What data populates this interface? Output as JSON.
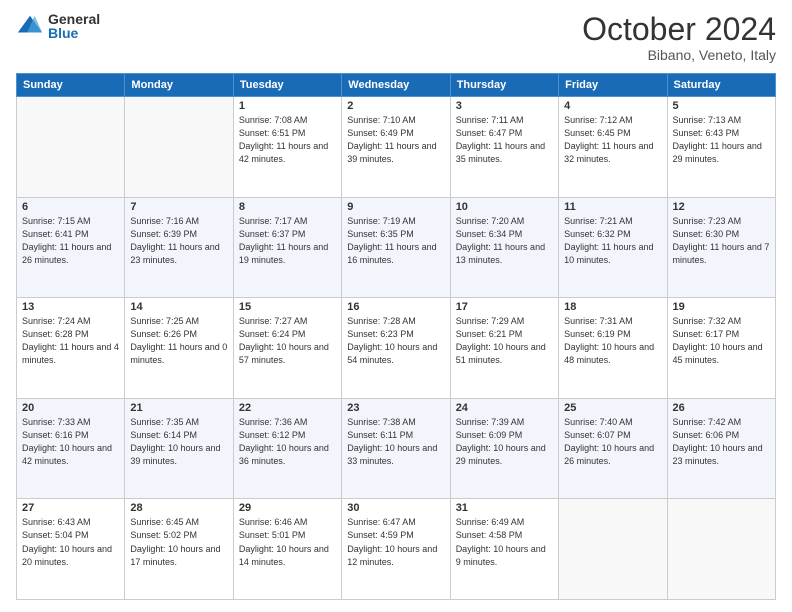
{
  "header": {
    "logo_general": "General",
    "logo_blue": "Blue",
    "month_title": "October 2024",
    "location": "Bibano, Veneto, Italy"
  },
  "weekdays": [
    "Sunday",
    "Monday",
    "Tuesday",
    "Wednesday",
    "Thursday",
    "Friday",
    "Saturday"
  ],
  "weeks": [
    [
      {
        "day": "",
        "info": ""
      },
      {
        "day": "",
        "info": ""
      },
      {
        "day": "1",
        "info": "Sunrise: 7:08 AM\nSunset: 6:51 PM\nDaylight: 11 hours and 42 minutes."
      },
      {
        "day": "2",
        "info": "Sunrise: 7:10 AM\nSunset: 6:49 PM\nDaylight: 11 hours and 39 minutes."
      },
      {
        "day": "3",
        "info": "Sunrise: 7:11 AM\nSunset: 6:47 PM\nDaylight: 11 hours and 35 minutes."
      },
      {
        "day": "4",
        "info": "Sunrise: 7:12 AM\nSunset: 6:45 PM\nDaylight: 11 hours and 32 minutes."
      },
      {
        "day": "5",
        "info": "Sunrise: 7:13 AM\nSunset: 6:43 PM\nDaylight: 11 hours and 29 minutes."
      }
    ],
    [
      {
        "day": "6",
        "info": "Sunrise: 7:15 AM\nSunset: 6:41 PM\nDaylight: 11 hours and 26 minutes."
      },
      {
        "day": "7",
        "info": "Sunrise: 7:16 AM\nSunset: 6:39 PM\nDaylight: 11 hours and 23 minutes."
      },
      {
        "day": "8",
        "info": "Sunrise: 7:17 AM\nSunset: 6:37 PM\nDaylight: 11 hours and 19 minutes."
      },
      {
        "day": "9",
        "info": "Sunrise: 7:19 AM\nSunset: 6:35 PM\nDaylight: 11 hours and 16 minutes."
      },
      {
        "day": "10",
        "info": "Sunrise: 7:20 AM\nSunset: 6:34 PM\nDaylight: 11 hours and 13 minutes."
      },
      {
        "day": "11",
        "info": "Sunrise: 7:21 AM\nSunset: 6:32 PM\nDaylight: 11 hours and 10 minutes."
      },
      {
        "day": "12",
        "info": "Sunrise: 7:23 AM\nSunset: 6:30 PM\nDaylight: 11 hours and 7 minutes."
      }
    ],
    [
      {
        "day": "13",
        "info": "Sunrise: 7:24 AM\nSunset: 6:28 PM\nDaylight: 11 hours and 4 minutes."
      },
      {
        "day": "14",
        "info": "Sunrise: 7:25 AM\nSunset: 6:26 PM\nDaylight: 11 hours and 0 minutes."
      },
      {
        "day": "15",
        "info": "Sunrise: 7:27 AM\nSunset: 6:24 PM\nDaylight: 10 hours and 57 minutes."
      },
      {
        "day": "16",
        "info": "Sunrise: 7:28 AM\nSunset: 6:23 PM\nDaylight: 10 hours and 54 minutes."
      },
      {
        "day": "17",
        "info": "Sunrise: 7:29 AM\nSunset: 6:21 PM\nDaylight: 10 hours and 51 minutes."
      },
      {
        "day": "18",
        "info": "Sunrise: 7:31 AM\nSunset: 6:19 PM\nDaylight: 10 hours and 48 minutes."
      },
      {
        "day": "19",
        "info": "Sunrise: 7:32 AM\nSunset: 6:17 PM\nDaylight: 10 hours and 45 minutes."
      }
    ],
    [
      {
        "day": "20",
        "info": "Sunrise: 7:33 AM\nSunset: 6:16 PM\nDaylight: 10 hours and 42 minutes."
      },
      {
        "day": "21",
        "info": "Sunrise: 7:35 AM\nSunset: 6:14 PM\nDaylight: 10 hours and 39 minutes."
      },
      {
        "day": "22",
        "info": "Sunrise: 7:36 AM\nSunset: 6:12 PM\nDaylight: 10 hours and 36 minutes."
      },
      {
        "day": "23",
        "info": "Sunrise: 7:38 AM\nSunset: 6:11 PM\nDaylight: 10 hours and 33 minutes."
      },
      {
        "day": "24",
        "info": "Sunrise: 7:39 AM\nSunset: 6:09 PM\nDaylight: 10 hours and 29 minutes."
      },
      {
        "day": "25",
        "info": "Sunrise: 7:40 AM\nSunset: 6:07 PM\nDaylight: 10 hours and 26 minutes."
      },
      {
        "day": "26",
        "info": "Sunrise: 7:42 AM\nSunset: 6:06 PM\nDaylight: 10 hours and 23 minutes."
      }
    ],
    [
      {
        "day": "27",
        "info": "Sunrise: 6:43 AM\nSunset: 5:04 PM\nDaylight: 10 hours and 20 minutes."
      },
      {
        "day": "28",
        "info": "Sunrise: 6:45 AM\nSunset: 5:02 PM\nDaylight: 10 hours and 17 minutes."
      },
      {
        "day": "29",
        "info": "Sunrise: 6:46 AM\nSunset: 5:01 PM\nDaylight: 10 hours and 14 minutes."
      },
      {
        "day": "30",
        "info": "Sunrise: 6:47 AM\nSunset: 4:59 PM\nDaylight: 10 hours and 12 minutes."
      },
      {
        "day": "31",
        "info": "Sunrise: 6:49 AM\nSunset: 4:58 PM\nDaylight: 10 hours and 9 minutes."
      },
      {
        "day": "",
        "info": ""
      },
      {
        "day": "",
        "info": ""
      }
    ]
  ]
}
